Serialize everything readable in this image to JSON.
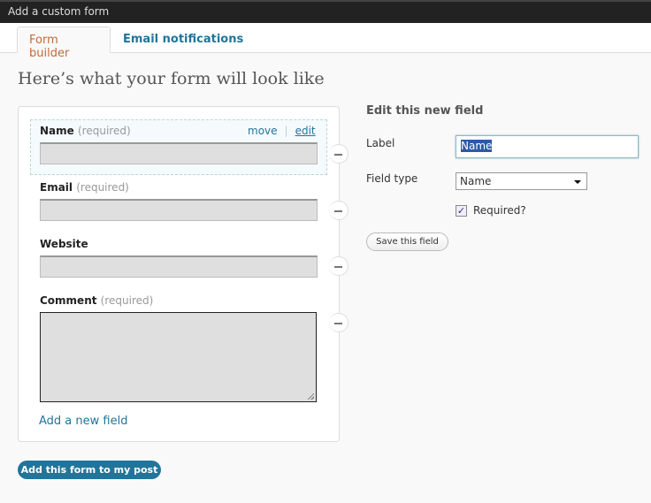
{
  "window": {
    "title": "Add a custom form"
  },
  "tabs": [
    {
      "label": "Form builder",
      "active": true
    },
    {
      "label": "Email notifications",
      "active": false
    }
  ],
  "heading": "Here’s what your form will look like",
  "form": {
    "fields": [
      {
        "label": "Name",
        "required": "(required)",
        "type": "input"
      },
      {
        "label": "Email",
        "required": "(required)",
        "type": "input"
      },
      {
        "label": "Website",
        "required": "",
        "type": "input"
      },
      {
        "label": "Comment",
        "required": "(required)",
        "type": "textarea"
      }
    ],
    "move_label": "move",
    "edit_label": "edit",
    "separator": "|",
    "add_field": "Add a new field"
  },
  "add_form_button": "Add this form to my post",
  "editor": {
    "title": "Edit this new field",
    "label_label": "Label",
    "label_value": "Name",
    "type_label": "Field type",
    "type_value": "Name",
    "required_label": "Required?",
    "required_checked": true,
    "check_glyph": "✓",
    "save_button": "Save this field"
  },
  "colors": {
    "accent": "#21759b",
    "active_tab": "#c06a3c",
    "titlebar": "#222222"
  }
}
